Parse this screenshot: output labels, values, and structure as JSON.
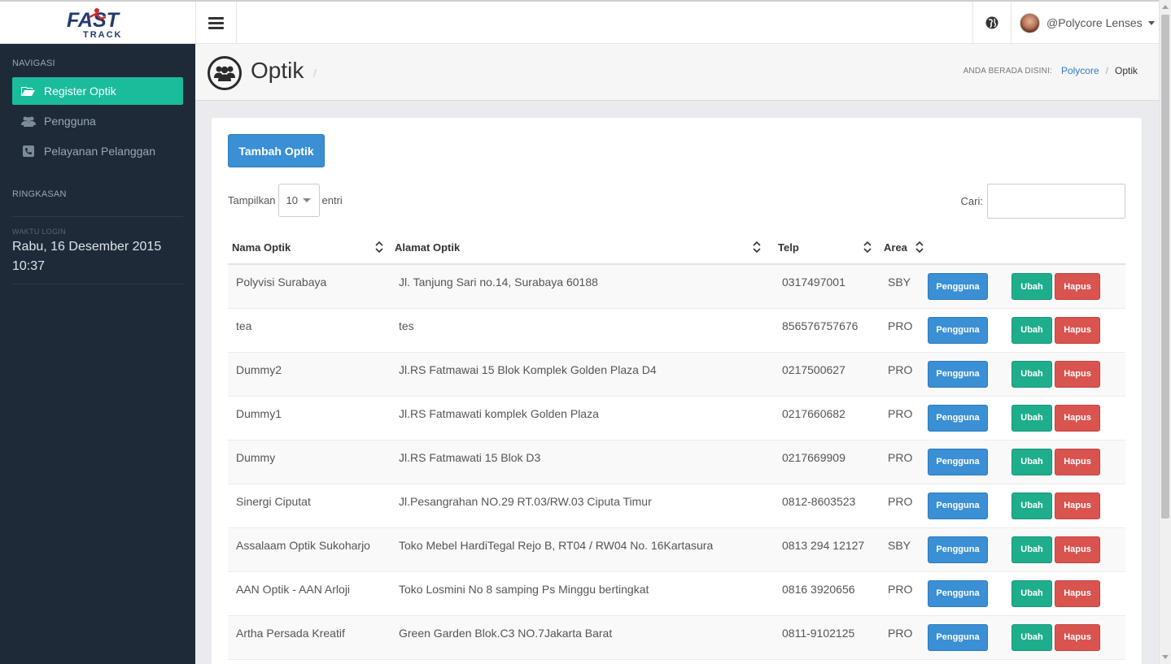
{
  "app": {
    "logo_top": "FAST",
    "logo_bottom": "TRACK",
    "user_name": "@Polycore Lenses"
  },
  "sidebar": {
    "heading_nav": "NAVIGASI",
    "items": [
      {
        "label": "Register Optik",
        "icon": "folder-open-icon",
        "active": true
      },
      {
        "label": "Pengguna",
        "icon": "users-icon",
        "active": false
      },
      {
        "label": "Pelayanan Pelanggan",
        "icon": "phone-icon",
        "active": false
      }
    ],
    "heading_summary": "RINGKASAN",
    "login_label": "WAKTU LOGIN",
    "login_value": "Rabu, 16 Desember 2015 10:37"
  },
  "header": {
    "title": "Optik",
    "title_slash": "/",
    "breadcrumb_label": "ANDA BERADA DISINI:",
    "breadcrumb_link": "Polycore",
    "breadcrumb_sep": "/",
    "breadcrumb_current": "Optik"
  },
  "toolbar": {
    "add_label": "Tambah Optik",
    "show_label": "Tampilkan",
    "show_value": "10",
    "entries_label": "entri",
    "search_label": "Cari:",
    "search_value": ""
  },
  "table": {
    "columns": [
      "Nama Optik",
      "Alamat Optik",
      "Telp",
      "Area"
    ],
    "btn_users": "Pengguna",
    "btn_edit": "Ubah",
    "btn_delete": "Hapus",
    "rows": [
      {
        "name": "Polyvisi Surabaya",
        "address": "Jl. Tanjung Sari no.14, Surabaya 60188",
        "phone": "0317497001",
        "area": "SBY"
      },
      {
        "name": "tea",
        "address": "tes",
        "phone": "856576757676",
        "area": "PRO"
      },
      {
        "name": "Dummy2",
        "address": "Jl.RS Fatmawai 15 Blok Komplek Golden Plaza D4",
        "phone": "0217500627",
        "area": "PRO"
      },
      {
        "name": "Dummy1",
        "address": "Jl.RS Fatmawati komplek Golden Plaza",
        "phone": "0217660682",
        "area": "PRO"
      },
      {
        "name": "Dummy",
        "address": "Jl.RS Fatmawati 15 Blok D3",
        "phone": "0217669909",
        "area": "PRO"
      },
      {
        "name": "Sinergi Ciputat",
        "address": "Jl.Pesangrahan NO.29 RT.03/RW.03 Ciputa Timur",
        "phone": "0812-8603523",
        "area": "PRO"
      },
      {
        "name": "Assalaam Optik Sukoharjo",
        "address": "Toko Mebel HardiTegal Rejo B, RT04 / RW04 No. 16Kartasura",
        "phone": "0813 294 12127",
        "area": "SBY"
      },
      {
        "name": "AAN Optik - AAN Arloji",
        "address": "Toko Losmini No 8 samping Ps Minggu bertingkat",
        "phone": "0816 3920656",
        "area": "PRO"
      },
      {
        "name": "Artha Persada Kreatif",
        "address": "Green Garden Blok.C3 NO.7Jakarta Barat",
        "phone": "0811-9102125",
        "area": "PRO"
      }
    ]
  },
  "colors": {
    "sidebar_bg": "#1e2a38",
    "active_accent": "#1abc9c",
    "primary_button": "#3a8fd5",
    "edit_button": "#1fae8c",
    "delete_button": "#d9534f"
  }
}
